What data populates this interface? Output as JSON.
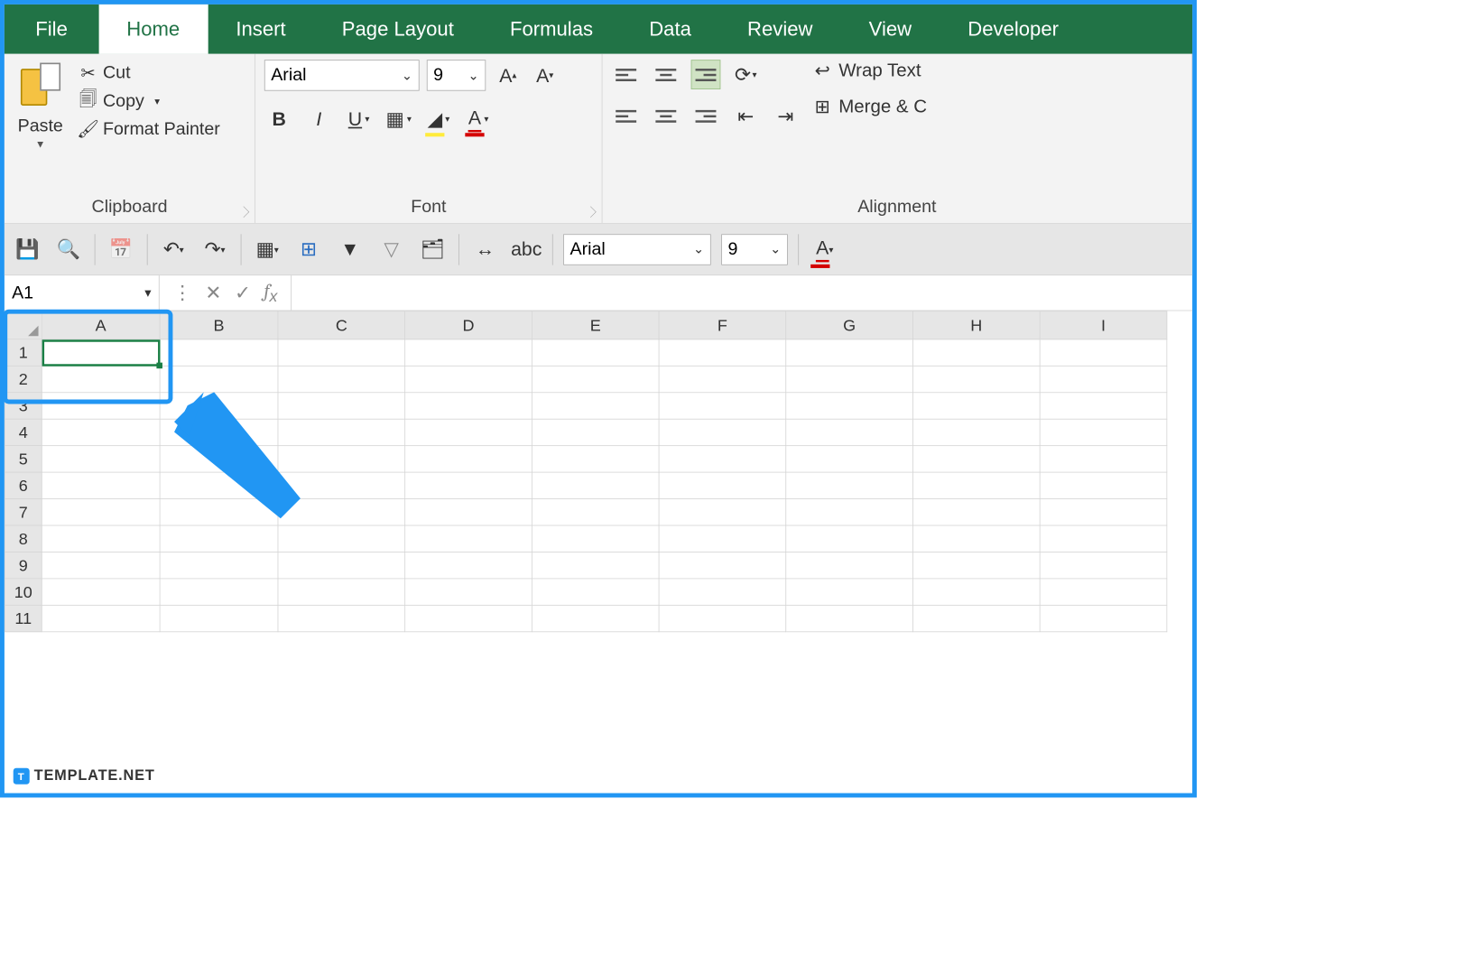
{
  "tabs": [
    "File",
    "Home",
    "Insert",
    "Page Layout",
    "Formulas",
    "Data",
    "Review",
    "View",
    "Developer"
  ],
  "active_tab": "Home",
  "clipboard": {
    "paste": "Paste",
    "cut": "Cut",
    "copy": "Copy",
    "format_painter": "Format Painter",
    "group": "Clipboard"
  },
  "font": {
    "name": "Arial",
    "size": "9",
    "group": "Font"
  },
  "alignment": {
    "wrap": "Wrap Text",
    "merge": "Merge & C",
    "group": "Alignment"
  },
  "qat": {
    "font": "Arial",
    "size": "9"
  },
  "name_box": "A1",
  "columns": [
    "A",
    "B",
    "C",
    "D",
    "E",
    "F",
    "G",
    "H",
    "I"
  ],
  "rows": [
    "1",
    "2",
    "3",
    "4",
    "5",
    "6",
    "7",
    "8",
    "9",
    "10",
    "11"
  ],
  "selected_cell": "A1",
  "watermark": "TEMPLATE.NET"
}
